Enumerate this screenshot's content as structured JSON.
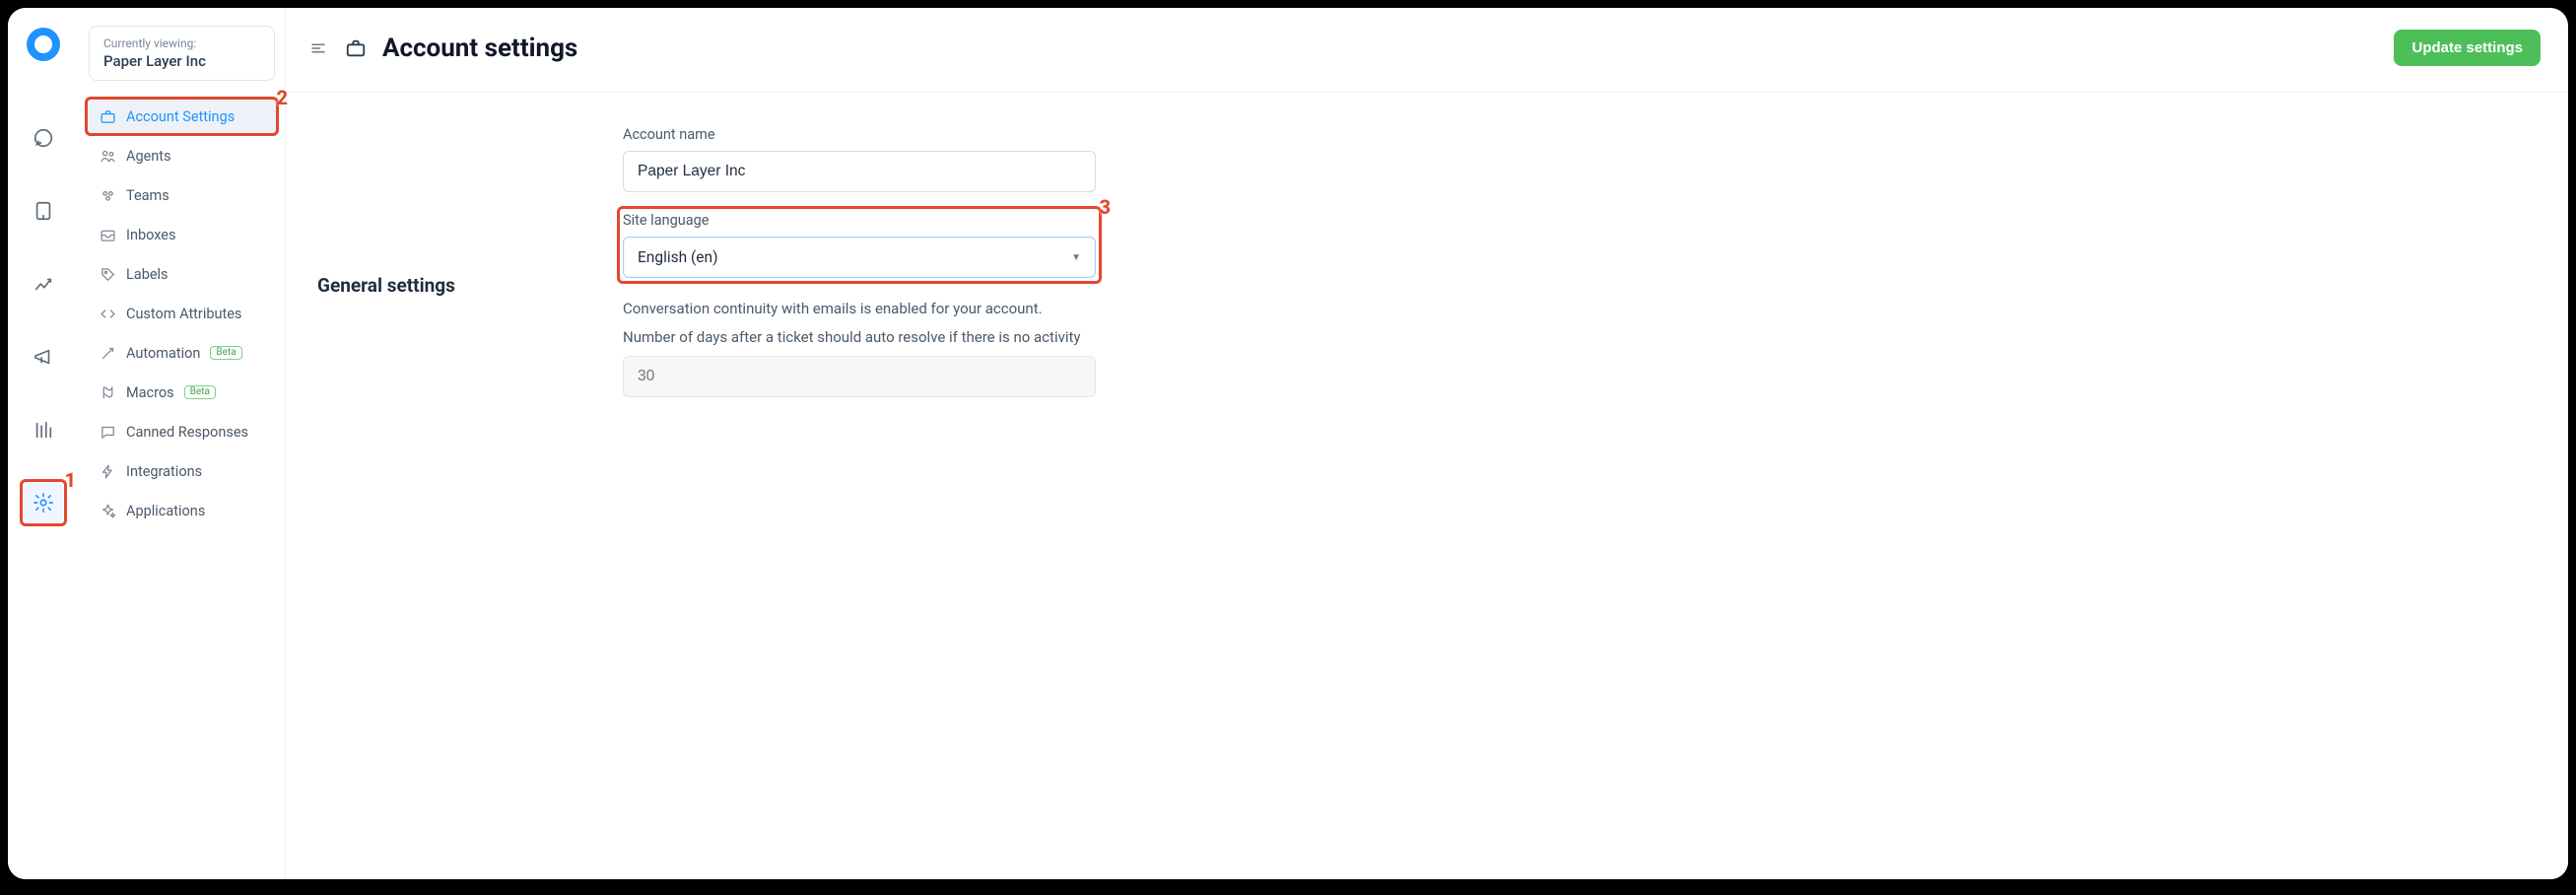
{
  "viewing": {
    "label": "Currently viewing:",
    "account": "Paper Layer Inc"
  },
  "nav": {
    "account_settings": "Account Settings",
    "agents": "Agents",
    "teams": "Teams",
    "inboxes": "Inboxes",
    "labels": "Labels",
    "custom_attributes": "Custom Attributes",
    "automation": "Automation",
    "macros": "Macros",
    "canned": "Canned Responses",
    "integrations": "Integrations",
    "applications": "Applications",
    "beta": "Beta"
  },
  "header": {
    "title": "Account settings",
    "update": "Update settings"
  },
  "section": {
    "general": "General settings"
  },
  "form": {
    "account_name_label": "Account name",
    "account_name_value": "Paper Layer Inc",
    "site_language_label": "Site language",
    "site_language_value": "English (en)",
    "continuity_text": "Conversation continuity with emails is enabled for your account.",
    "autoresolve_text": "Number of days after a ticket should auto resolve if there is no activity",
    "autoresolve_placeholder": "30"
  },
  "annotations": {
    "one": "1",
    "two": "2",
    "three": "3"
  }
}
